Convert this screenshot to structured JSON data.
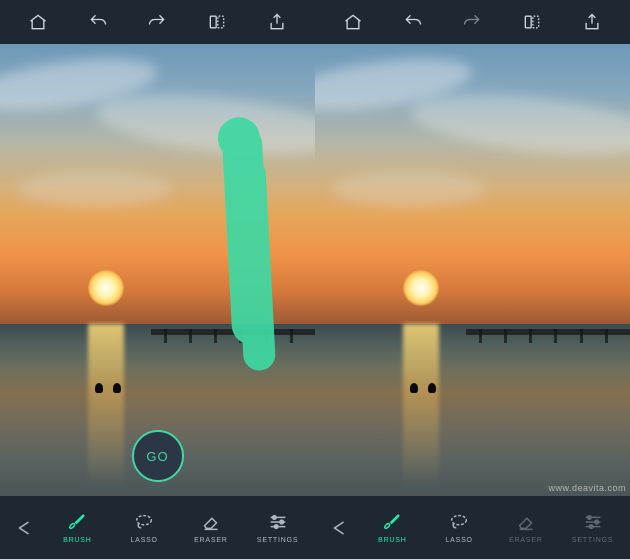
{
  "top_toolbar": {
    "home_icon": "home-icon",
    "undo_icon": "undo-icon",
    "redo_icon": "redo-icon",
    "compare_icon": "compare-icon",
    "share_icon": "share-icon"
  },
  "canvas": {
    "go_button_label": "GO",
    "brush_color": "#3fd8a3"
  },
  "bottom_toolbar_left": {
    "back_icon": "back-arrow-icon",
    "tools": [
      {
        "id": "brush",
        "label": "BRUSH",
        "active": true
      },
      {
        "id": "lasso",
        "label": "LASSO",
        "active": false
      },
      {
        "id": "eraser",
        "label": "ERASER",
        "active": false
      },
      {
        "id": "settings",
        "label": "SETTINGS",
        "active": false
      }
    ]
  },
  "bottom_toolbar_right": {
    "back_icon": "back-arrow-icon",
    "tools": [
      {
        "id": "brush",
        "label": "BRUSH",
        "active": true
      },
      {
        "id": "lasso",
        "label": "LASSO",
        "active": false
      },
      {
        "id": "eraser",
        "label": "ERASER",
        "active": false
      },
      {
        "id": "settings",
        "label": "SETTINGS",
        "active": false
      }
    ]
  },
  "watermark": "www.deavita.com"
}
